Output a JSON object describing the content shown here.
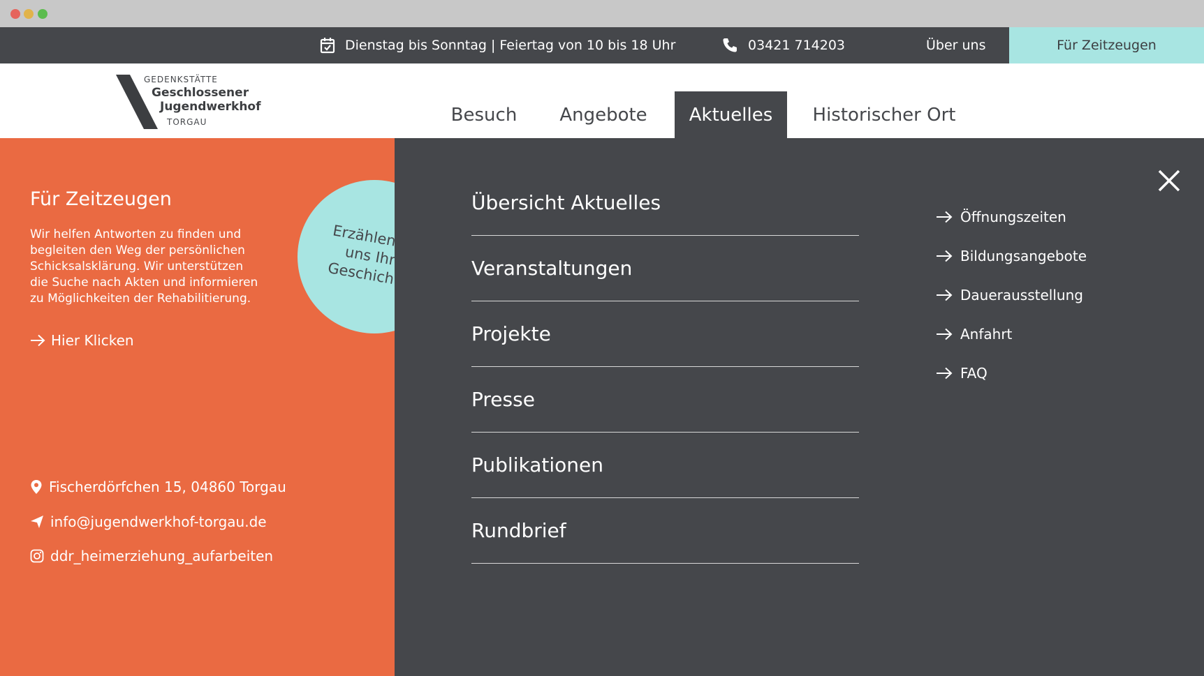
{
  "topbar": {
    "hours": "Dienstag bis Sonntag | Feiertag von 10 bis 18 Uhr",
    "phone": "03421 714203",
    "about": "Über uns",
    "cta": "Für Zeitzeugen"
  },
  "logo": {
    "line1": "GEDENKSTÄTTE",
    "line2": "Geschlossener",
    "line3": "Jugendwerkhof",
    "line4": "TORGAU"
  },
  "nav": {
    "besuch": "Besuch",
    "angebote": "Angebote",
    "aktuelles": "Aktuelles",
    "historisch": "Historischer Ort"
  },
  "left": {
    "title": "Für Zeitzeugen",
    "description": "Wir helfen Antworten zu finden und begleiten den Weg der persönlichen Schicksalsklärung. Wir unterstützen die Suche nach Akten und informieren zu Möglichkeiten der Rehabilitierung.",
    "link": "Hier Klicken",
    "address": "Fischerdörfchen 15, 04860 Torgau",
    "email": "info@jugendwerkhof-torgau.de",
    "instagram": "ddr_heimerziehung_aufarbeiten"
  },
  "bubble": {
    "text": "Erzählen Sie uns Ihre Geschichte!"
  },
  "menu": {
    "items": [
      "Übersicht Aktuelles",
      "Veranstaltungen",
      "Projekte",
      "Presse",
      "Publikationen",
      "Rundbrief"
    ]
  },
  "quicklinks": {
    "items": [
      "Öffnungszeiten",
      "Bildungsangebote",
      "Dauerausstellung",
      "Anfahrt",
      "FAQ"
    ]
  },
  "colors": {
    "dark": "#45474b",
    "orange": "#ea6a42",
    "turquoise": "#a8e5e2"
  },
  "icons": {
    "hours": "calendar-check-icon",
    "phone": "phone-icon",
    "address": "map-pin-icon",
    "email": "paper-plane-icon",
    "instagram": "instagram-icon",
    "link": "arrow-right-icon",
    "close": "close-icon"
  }
}
